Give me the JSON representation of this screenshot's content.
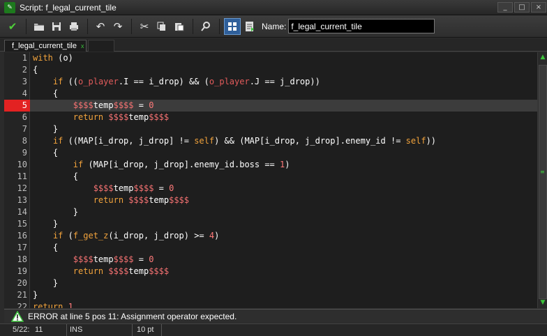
{
  "window": {
    "title": "Script: f_legal_current_tile",
    "controls": [
      "_",
      "□",
      "×"
    ]
  },
  "toolbar": {
    "name_label": "Name:",
    "name_value": "f_legal_current_tile"
  },
  "tabs": [
    {
      "label": "f_legal_current_tile",
      "close": "x"
    }
  ],
  "code_lines": [
    {
      "n": "1",
      "html": "<span class='kw'>with</span> (o)"
    },
    {
      "n": "2",
      "html": "<span class='br'>{</span>"
    },
    {
      "n": "3",
      "html": "    <span class='kw'>if</span> ((<span class='obj'>o_player</span>.I == i_drop) &amp;&amp; (<span class='obj'>o_player</span>.J == j_drop))"
    },
    {
      "n": "4",
      "html": "    <span class='br'>{</span>"
    },
    {
      "n": "5",
      "html": "        <span class='tmpvar'>$$$$</span>temp<span class='tmpvar'>$$$$</span> = <span class='num'>0</span>",
      "highlight": true
    },
    {
      "n": "6",
      "html": "        <span class='kw'>return</span> <span class='tmpvar'>$$$$</span>temp<span class='tmpvar'>$$$$</span>"
    },
    {
      "n": "7",
      "html": "    <span class='br'>}</span>"
    },
    {
      "n": "8",
      "html": "    <span class='kw'>if</span> ((MAP[i_drop, j_drop] != <span class='self'>self</span>) &amp;&amp; (MAP[i_drop, j_drop].enemy_id != <span class='self'>self</span>))"
    },
    {
      "n": "9",
      "html": "    <span class='br'>{</span>"
    },
    {
      "n": "10",
      "html": "        <span class='kw'>if</span> (MAP[i_drop, j_drop].enemy_id.boss == <span class='num'>1</span>)"
    },
    {
      "n": "11",
      "html": "        <span class='br'>{</span>"
    },
    {
      "n": "12",
      "html": "            <span class='tmpvar'>$$$$</span>temp<span class='tmpvar'>$$$$</span> = <span class='num'>0</span>"
    },
    {
      "n": "13",
      "html": "            <span class='kw'>return</span> <span class='tmpvar'>$$$$</span>temp<span class='tmpvar'>$$$$</span>"
    },
    {
      "n": "14",
      "html": "        <span class='br'>}</span>"
    },
    {
      "n": "15",
      "html": "    <span class='br'>}</span>"
    },
    {
      "n": "16",
      "html": "    <span class='kw'>if</span> (<span class='fn'>f_get_z</span>(i_drop, j_drop) &gt;= <span class='num'>4</span>)"
    },
    {
      "n": "17",
      "html": "    <span class='br'>{</span>"
    },
    {
      "n": "18",
      "html": "        <span class='tmpvar'>$$$$</span>temp<span class='tmpvar'>$$$$</span> = <span class='num'>0</span>"
    },
    {
      "n": "19",
      "html": "        <span class='kw'>return</span> <span class='tmpvar'>$$$$</span>temp<span class='tmpvar'>$$$$</span>"
    },
    {
      "n": "20",
      "html": "    <span class='br'>}</span>"
    },
    {
      "n": "21",
      "html": "<span class='br'>}</span>"
    },
    {
      "n": "22",
      "html": "<span class='kw'>return</span> <span class='num'>1</span>"
    }
  ],
  "error": {
    "message": "ERROR at line 5 pos 11: Assignment operator expected."
  },
  "status": {
    "position": "5/22:",
    "column": "11",
    "mode": "INS",
    "font_size": "10 pt"
  },
  "icons": {
    "check": "check-icon",
    "open": "open-folder-icon",
    "save": "save-icon",
    "print": "print-icon",
    "undo": "undo-icon",
    "redo": "redo-icon",
    "cut": "cut-icon",
    "copy": "copy-icon",
    "paste": "paste-icon",
    "find": "find-icon",
    "grid": "grid-icon",
    "document": "document-icon",
    "warning": "warning-icon"
  },
  "colors": {
    "error_line_marker": "#e32222",
    "keyword": "#f2a33c",
    "object": "#e25b5b",
    "number": "#ff7a7a"
  }
}
